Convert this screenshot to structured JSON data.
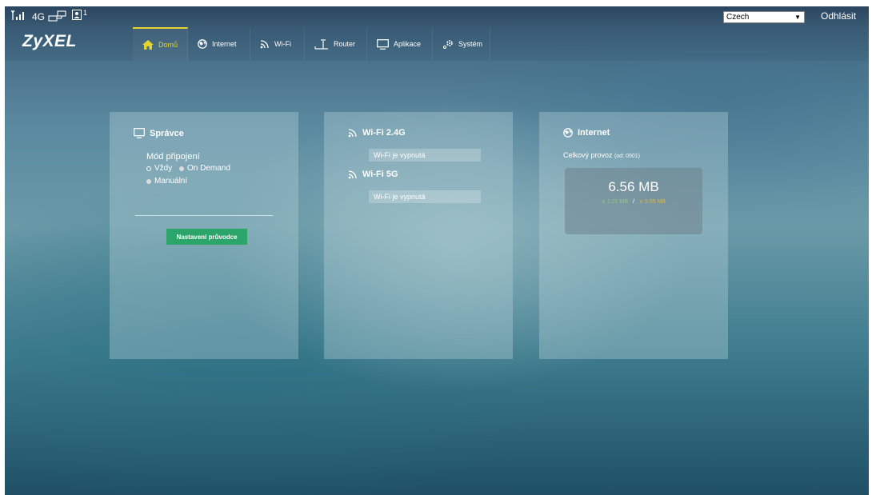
{
  "status_bar": {
    "network_type": "4G",
    "device_count": "1",
    "language": "Czech",
    "logout_label": "Odhlásit"
  },
  "nav": {
    "logo": "ZyXEL",
    "items": [
      {
        "label": "Domů",
        "icon": "home-icon",
        "active": true
      },
      {
        "label": "Internet",
        "icon": "globe-icon",
        "active": false
      },
      {
        "label": "Wi-Fi",
        "icon": "wifi-icon",
        "active": false
      },
      {
        "label": "Router",
        "icon": "router-icon",
        "active": false
      },
      {
        "label": "Aplikace",
        "icon": "monitor-icon",
        "active": false
      },
      {
        "label": "Systém",
        "icon": "gear-icon",
        "active": false
      }
    ]
  },
  "admin": {
    "title": "Správce",
    "connection_mode_label": "Mód připojení",
    "options": [
      {
        "label": "Vždy",
        "selected": true
      },
      {
        "label": "On Demand",
        "selected": false
      },
      {
        "label": "Manuální",
        "selected": false
      }
    ],
    "wizard_button": "Nastavení průvodce"
  },
  "wifi": {
    "band24": {
      "title": "Wi-Fi 2.4G",
      "status": "Wi-Fi je vypnutá"
    },
    "band5": {
      "title": "Wi-Fi 5G",
      "status": "Wi-Fi je vypnutá"
    }
  },
  "internet": {
    "title": "Internet",
    "traffic_label": "Celkový provoz",
    "traffic_since": "(od: 0501)",
    "total": "6.56 MB",
    "upload": "1.01 MB",
    "separator": "/",
    "download": "5.55 MB"
  },
  "colors": {
    "accent_active": "#e3d32e",
    "button_green": "#2ca56a",
    "upload_green": "#8fd06a",
    "download_gold": "#d2b85a"
  }
}
